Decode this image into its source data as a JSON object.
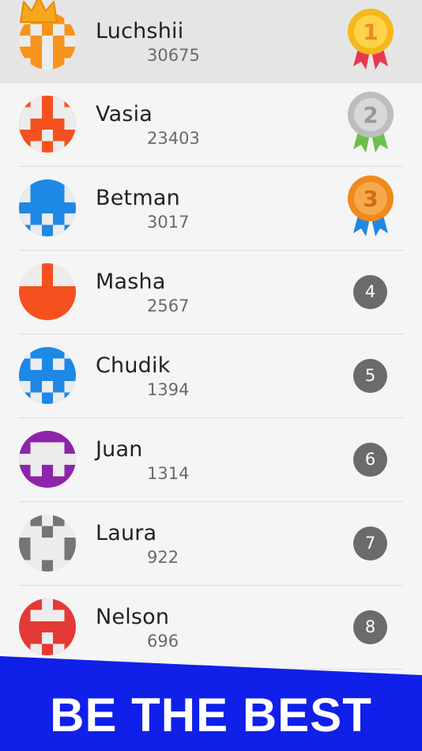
{
  "leaderboard": [
    {
      "name": "Luchshii",
      "score": "30675",
      "rank": "1",
      "avatar_color": "#f7941d",
      "medal": "gold"
    },
    {
      "name": "Vasia",
      "score": "23403",
      "rank": "2",
      "avatar_color": "#f4511e",
      "medal": "silver"
    },
    {
      "name": "Betman",
      "score": "3017",
      "rank": "3",
      "avatar_color": "#1e88e5",
      "medal": "bronze"
    },
    {
      "name": "Masha",
      "score": "2567",
      "rank": "4",
      "avatar_color": "#f4511e"
    },
    {
      "name": "Chudik",
      "score": "1394",
      "rank": "5",
      "avatar_color": "#1e88e5"
    },
    {
      "name": "Juan",
      "score": "1314",
      "rank": "6",
      "avatar_color": "#8e24aa"
    },
    {
      "name": "Laura",
      "score": "922",
      "rank": "7",
      "avatar_color": "#757575"
    },
    {
      "name": "Nelson",
      "score": "696",
      "rank": "8",
      "avatar_color": "#e53935"
    }
  ],
  "banner": {
    "text": "BE THE BEST",
    "color": "#1020e8"
  },
  "icons": {
    "crown": "crown-icon",
    "medal": "medal-icon",
    "avatar": "pixel-avatar-icon"
  },
  "colors": {
    "first_row_bg": "#e5e5e5",
    "gold": "#f5b81c",
    "silver": "#bdbdbd",
    "bronze": "#f08a1c",
    "rank_badge": "#6b6b6b"
  }
}
